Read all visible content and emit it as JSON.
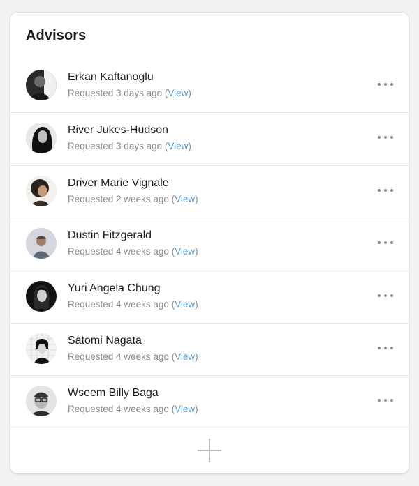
{
  "title": "Advisors",
  "advisors": [
    {
      "name": "Erkan Kaftanoglu",
      "status": "Requested 3 days ago",
      "link": "View"
    },
    {
      "name": "River Jukes-Hudson",
      "status": "Requested 3 days ago",
      "link": "View"
    },
    {
      "name": "Driver Marie Vignale",
      "status": "Requested 2 weeks ago",
      "link": "View"
    },
    {
      "name": "Dustin Fitzgerald",
      "status": "Requested 4 weeks ago",
      "link": "View"
    },
    {
      "name": "Yuri Angela Chung",
      "status": "Requested 4 weeks ago",
      "link": "View"
    },
    {
      "name": "Satomi Nagata",
      "status": "Requested 4 weeks ago",
      "link": "View"
    },
    {
      "name": "Wseem Billy Baga",
      "status": "Requested 4 weeks ago",
      "link": "View"
    }
  ],
  "icons": {
    "row_menu": "more-horizontal-icon",
    "add": "plus-icon"
  },
  "colors": {
    "link": "#5b9bd5",
    "text": "#1e1e1e",
    "muted": "#8a8a8a"
  }
}
